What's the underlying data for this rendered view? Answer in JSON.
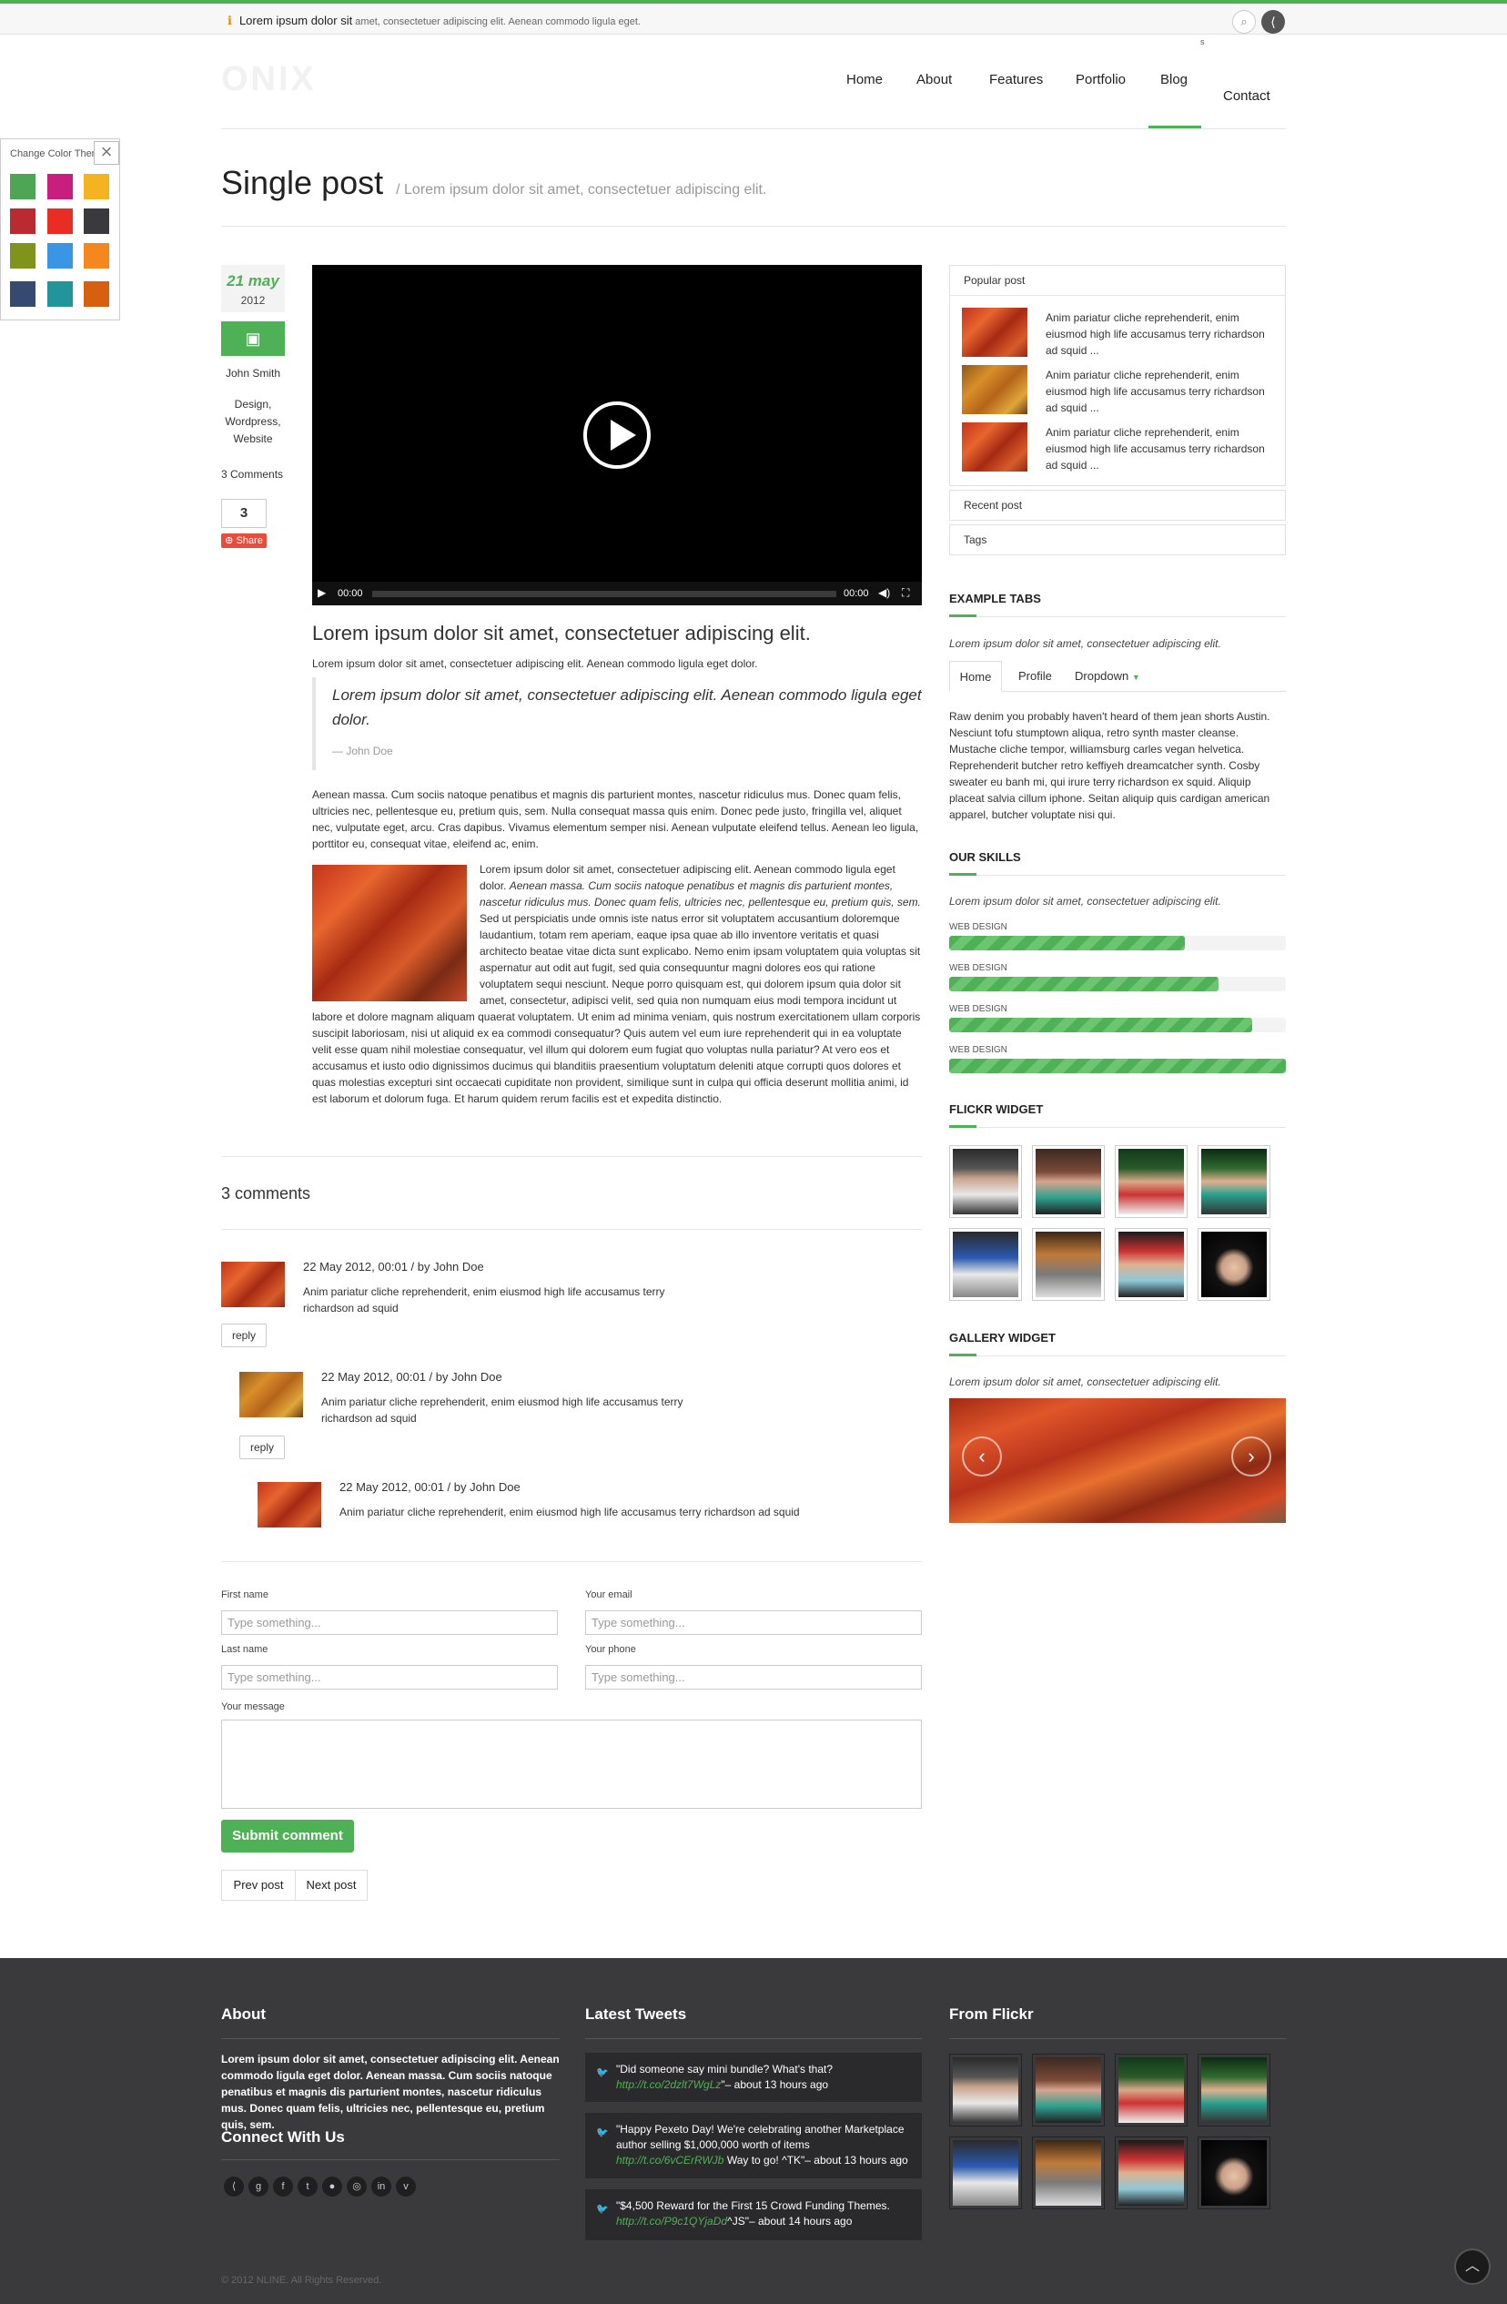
{
  "topbar": {
    "notice_strong": "Lorem ipsum dolor sit",
    "notice_rest": " amet, consectetuer adipiscing elit. Aenean commodo ligula eget.",
    "search_icon": "search-icon",
    "share_icon": "share-icon",
    "small_mark": "s"
  },
  "header": {
    "logo": "ONIX",
    "nav": [
      "Home",
      "About",
      "Features",
      "Portfolio",
      "Blog",
      "Contact"
    ],
    "active": "Blog"
  },
  "color_panel": {
    "title": "Change Color Theme",
    "swatches": [
      "#4fa556",
      "#c81f7f",
      "#f4b421",
      "#b92b30",
      "#e82e24",
      "#3a3a3e",
      "#80931c",
      "#3996e4",
      "#f5871f",
      "#364a6f",
      "#21959a",
      "#d6600f"
    ]
  },
  "page": {
    "title": "Single post",
    "subtitle": "Lorem ipsum dolor sit amet, consectetuer adipiscing elit."
  },
  "post_meta": {
    "day": "21 may",
    "year": "2012",
    "author": "John Smith",
    "tags": [
      "Design,",
      "Wordpress,",
      "Website"
    ],
    "comments": "3 Comments",
    "share_count": "3",
    "share_label": "Share"
  },
  "video": {
    "time_current": "00:00",
    "time_total": "00:00"
  },
  "article": {
    "heading": "Lorem ipsum dolor sit amet, consectetuer adipiscing elit.",
    "intro": "Lorem ipsum dolor sit amet, consectetuer adipiscing elit. Aenean commodo ligula eget dolor.",
    "quote": "Lorem ipsum dolor sit amet, consectetuer adipiscing elit. Aenean commodo ligula eget dolor.",
    "quote_author": "— John Doe",
    "p1": "Aenean massa. Cum sociis natoque penatibus et magnis dis parturient montes, nascetur ridiculus mus. Donec quam felis, ultricies nec, pellentesque eu, pretium quis, sem. Nulla consequat massa quis enim. Donec pede justo, fringilla vel, aliquet nec, vulputate eget, arcu. Cras dapibus. Vivamus elementum semper nisi. Aenean vulputate eleifend tellus. Aenean leo ligula, porttitor eu, consequat vitae, eleifend ac, enim.",
    "p2a": "Lorem ipsum dolor sit amet, consectetuer adipiscing elit. Aenean commodo ligula eget dolor. ",
    "p2b": "Aenean massa. Cum sociis natoque penatibus et magnis dis parturient montes, nascetur ridiculus mus. Donec quam felis, ultricies nec, pellentesque eu, pretium quis, sem.",
    "p2c": " Sed ut perspiciatis unde omnis iste natus error sit voluptatem accusantium doloremque laudantium, totam rem aperiam, eaque ipsa quae ab illo inventore veritatis et quasi architecto beatae vitae dicta sunt explicabo. Nemo enim ipsam voluptatem quia voluptas sit aspernatur aut odit aut fugit, sed quia consequuntur magni dolores eos qui ratione voluptatem sequi nesciunt. Neque porro quisquam est, qui dolorem ipsum quia dolor sit amet, consectetur, adipisci velit, sed quia non numquam eius modi tempora incidunt ut labore et dolore magnam aliquam quaerat voluptatem. Ut enim ad minima veniam, quis nostrum exercitationem ullam corporis suscipit laboriosam, nisi ut aliquid ex ea commodi consequatur? Quis autem vel eum iure reprehenderit qui in ea voluptate velit esse quam nihil molestiae consequatur, vel illum qui dolorem eum fugiat quo voluptas nulla pariatur? At vero eos et accusamus et iusto odio dignissimos ducimus qui blanditiis praesentium voluptatum deleniti atque corrupti quos dolores et quas molestias excepturi sint occaecati cupiditate non provident, similique sunt in culpa qui officia deserunt mollitia animi, id est laborum et dolorum fuga. Et harum quidem rerum facilis est et expedita distinctio."
  },
  "comments": {
    "heading": "3 comments",
    "items": [
      {
        "header": "22 May 2012, 00:01 / by John Doe",
        "body": "Anim pariatur cliche reprehenderit, enim eiusmod high life accusamus terry richardson ad squid",
        "reply": "reply"
      },
      {
        "header": "22 May 2012, 00:01 / by John Doe",
        "body": "Anim pariatur cliche reprehenderit, enim eiusmod high life accusamus terry richardson ad squid",
        "reply": "reply"
      },
      {
        "header": "22 May 2012, 00:01 / by John Doe",
        "body": "Anim pariatur cliche reprehenderit, enim eiusmod high life accusamus terry richardson ad squid"
      }
    ]
  },
  "form": {
    "first_name_label": "First name",
    "email_label": "Your email",
    "last_name_label": "Last name",
    "phone_label": "Your phone",
    "message_label": "Your message",
    "placeholder": "Type something...",
    "submit": "Submit comment",
    "prev": "Prev post",
    "next": "Next post"
  },
  "sidebar": {
    "popular_title": "Popular post",
    "popular_items": [
      "Anim pariatur cliche reprehenderit, enim eiusmod high life accusamus terry richardson ad squid ...",
      "Anim pariatur cliche reprehenderit, enim eiusmod high life accusamus terry richardson ad squid ...",
      "Anim pariatur cliche reprehenderit, enim eiusmod high life accusamus terry richardson ad squid ..."
    ],
    "recent_title": "Recent post",
    "tags_title": "Tags",
    "tabs_title": "EXAMPLE TABS",
    "tabs_intro": "Lorem ipsum dolor sit amet, consectetuer adipiscing elit.",
    "tabs": [
      "Home",
      "Profile",
      "Dropdown"
    ],
    "tab_content": "Raw denim you probably haven't heard of them jean shorts Austin. Nesciunt tofu stumptown aliqua, retro synth master cleanse. Mustache cliche tempor, williamsburg carles vegan helvetica. Reprehenderit butcher retro keffiyeh dreamcatcher synth. Cosby sweater eu banh mi, qui irure terry richardson ex squid. Aliquip placeat salvia cillum iphone. Seitan aliquip quis cardigan american apparel, butcher voluptate nisi qui.",
    "skills_title": "OUR SKILLS",
    "skills_intro": "Lorem ipsum dolor sit amet, consectetuer adipiscing elit.",
    "skills": [
      {
        "label": "WEB DESIGN",
        "value": 0.7
      },
      {
        "label": "WEB DESIGN",
        "value": 0.8
      },
      {
        "label": "WEB DESIGN",
        "value": 0.9
      },
      {
        "label": "WEB DESIGN",
        "value": 1.0
      }
    ],
    "flickr_title": "FLICKR WIDGET",
    "gallery_title": "GALLERY WIDGET",
    "gallery_intro": "Lorem ipsum dolor sit amet, consectetuer adipiscing elit."
  },
  "footer": {
    "about_title": "About",
    "about_text": "Lorem ipsum dolor sit amet, consectetuer adipiscing elit. Aenean commodo ligula eget dolor. Aenean massa. Cum sociis natoque penatibus et magnis dis parturient montes, nascetur ridiculus mus. Donec quam felis, ultricies nec, pellentesque eu, pretium quis, sem.",
    "connect_title": "Connect With Us",
    "social_icons": [
      "share-icon",
      "google-icon",
      "facebook-icon",
      "twitter-icon",
      "flickr-icon",
      "dribbble-icon",
      "linkedin-icon",
      "vimeo-icon"
    ],
    "tweets_title": "Latest Tweets",
    "tweets": [
      {
        "t1": "\"Did someone say mini bundle? What's that?",
        "link": "http://t.co/2dzlt7WgLz",
        "t2": "\"– about 13 hours ago"
      },
      {
        "t1": "\"Happy Pexeto Day! We're celebrating another Marketplace author selling $1,000,000 worth of items",
        "link": "http://t.co/6vCErRWJb",
        "t2": "Way to go! ^TK\"– about 13 hours ago"
      },
      {
        "t1": "\"$4,500 Reward for the First 15 Crowd Funding Themes.",
        "link": "http://t.co/P9c1QYjaDd",
        "t2": "^JS\"– about 14 hours ago"
      }
    ],
    "flickr_title": "From Flickr",
    "copyright": "© 2012 NLINE. All Rights Reserved."
  }
}
